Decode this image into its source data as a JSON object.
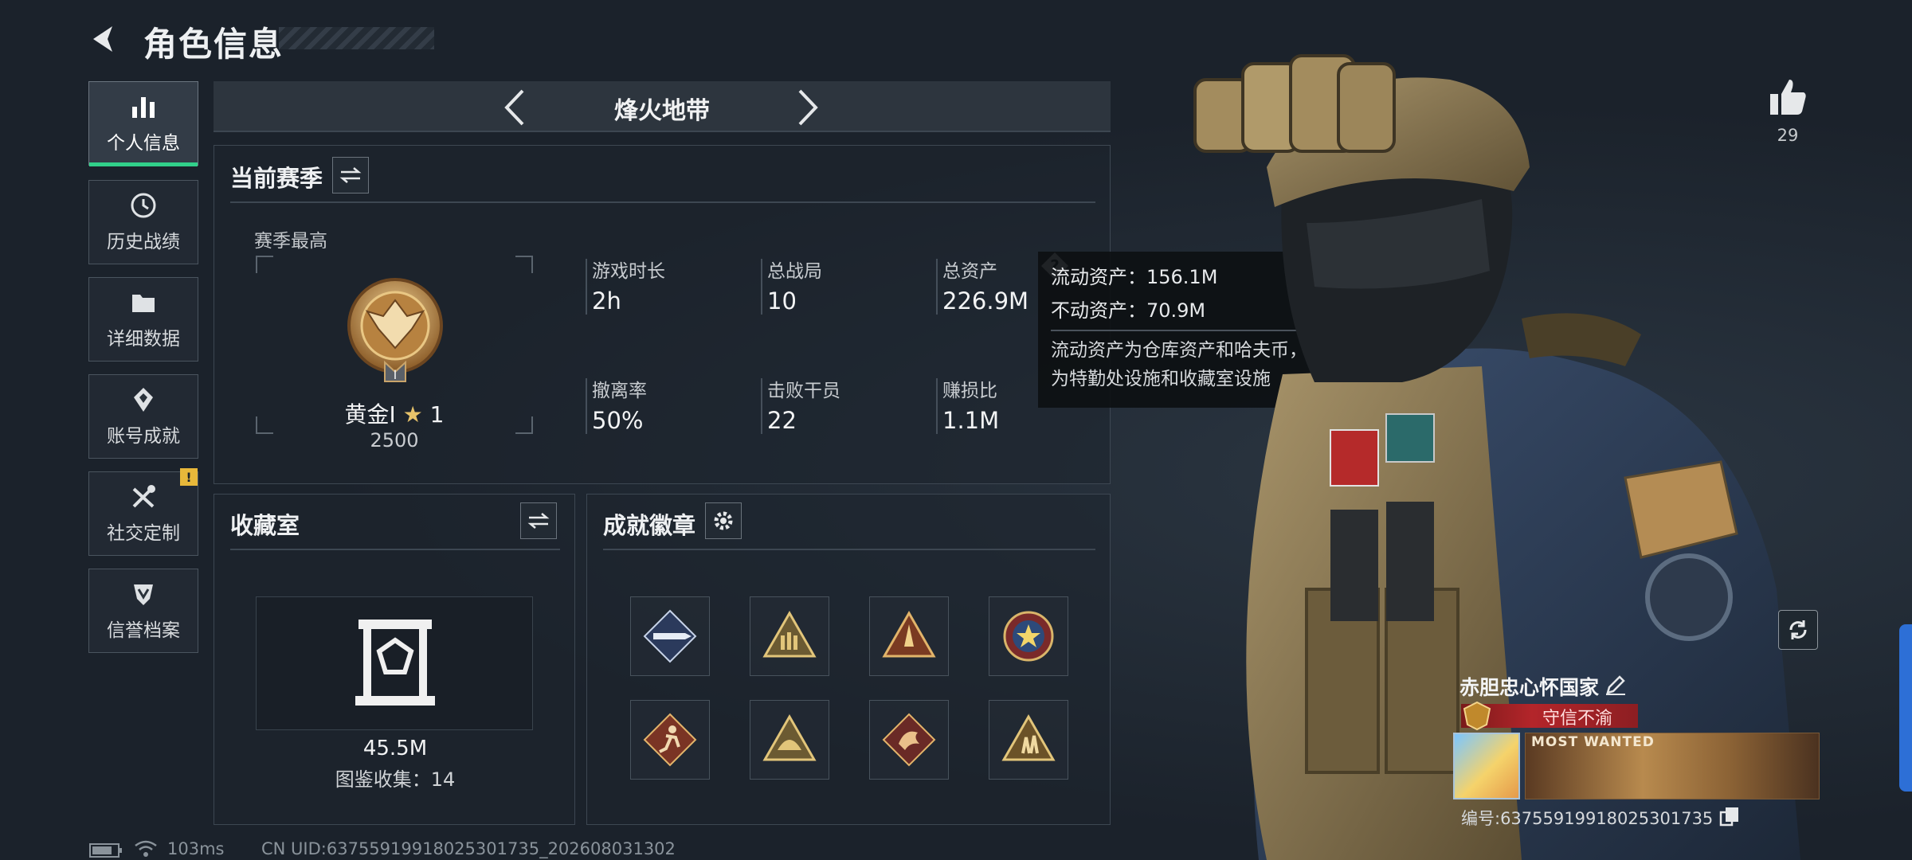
{
  "header": {
    "title": "角色信息"
  },
  "sidebar": {
    "items": [
      {
        "label": "个人信息",
        "icon": "bar-chart-icon",
        "active": true
      },
      {
        "label": "历史战绩",
        "icon": "history-icon"
      },
      {
        "label": "详细数据",
        "icon": "folder-icon"
      },
      {
        "label": "账号成就",
        "icon": "achievement-icon"
      },
      {
        "label": "社交定制",
        "icon": "tools-icon",
        "badge": "!"
      },
      {
        "label": "信誉档案",
        "icon": "shield-icon"
      }
    ]
  },
  "mode": {
    "title": "烽火地带"
  },
  "season": {
    "title": "当前赛季",
    "best_label": "赛季最高",
    "rank_name": "黄金Ⅰ",
    "rank_stars": "1",
    "rank_score": "2500",
    "stats": [
      {
        "label": "游戏时长",
        "value": "2h"
      },
      {
        "label": "总战局",
        "value": "10"
      },
      {
        "label": "总资产",
        "value": "226.9M"
      },
      {
        "label": "撤离率",
        "value": "50%"
      },
      {
        "label": "击败干员",
        "value": "22"
      },
      {
        "label": "赚损比",
        "value": "1.1M"
      }
    ]
  },
  "tooltip": {
    "liquid": "流动资产：156.1M",
    "fixed": "不动资产：70.9M",
    "desc_line1": "流动资产为仓库资产和哈夫币，不动资产",
    "desc_line2": "为特勤处设施和收藏室设施"
  },
  "collection": {
    "title": "收藏室",
    "value": "45.5M",
    "count_text": "图鉴收集：14"
  },
  "badges": {
    "title": "成就徽章",
    "items": [
      "badge-missile",
      "badge-ammo",
      "badge-rocket",
      "badge-star",
      "badge-runner",
      "badge-helmet",
      "badge-dragon",
      "badge-soldiers"
    ]
  },
  "profile": {
    "likes": "29",
    "name": "赤胆忠心怀国家",
    "reputation": "守信不渝",
    "banner_text": "MOST WANTED",
    "player_id": "编号:6375591991802530173​5"
  },
  "footer": {
    "ping": "103ms",
    "uid": "CN UID:6375591991802530173​5_202608031302"
  },
  "colors": {
    "accent_green": "#31d08a",
    "warning": "#e8b83a",
    "rep_red": "#b3252a"
  }
}
